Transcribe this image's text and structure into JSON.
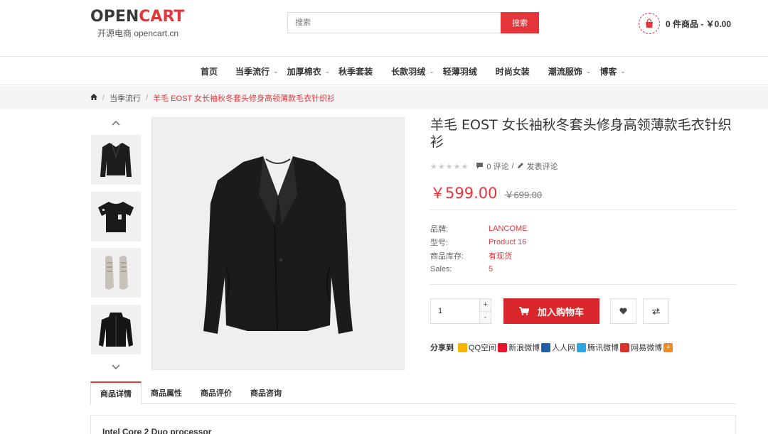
{
  "header": {
    "logo_text_dark": "OPEN",
    "logo_text_red": "CART",
    "logo_sub": "开源电商 opencart.cn",
    "search_placeholder": "搜索",
    "search_button": "搜索",
    "cart_text": "0 件商品 - ￥0.00"
  },
  "nav": {
    "items": [
      {
        "label": "首页",
        "has_caret": false
      },
      {
        "label": "当季流行",
        "has_caret": true
      },
      {
        "label": "加厚棉衣",
        "has_caret": true
      },
      {
        "label": "秋季套装",
        "has_caret": false
      },
      {
        "label": "长款羽绒",
        "has_caret": true
      },
      {
        "label": "轻薄羽绒",
        "has_caret": false
      },
      {
        "label": "时尚女装",
        "has_caret": false
      },
      {
        "label": "潮流服饰",
        "has_caret": true
      },
      {
        "label": "博客",
        "has_caret": true
      }
    ]
  },
  "breadcrumb": {
    "home_icon": "home-icon",
    "items": [
      "当季流行",
      "羊毛 EOST 女长袖秋冬套头修身高领薄款毛衣针织衫"
    ]
  },
  "gallery": {
    "thumbnails": [
      "black-blazer",
      "black-tshirt",
      "grey-sneakers",
      "black-zip-jacket"
    ],
    "main": "black-blazer"
  },
  "product": {
    "title": "羊毛 EOST 女长袖秋冬套头修身高领薄款毛衣针织衫",
    "rating": 0,
    "reviews_text": "0 评论",
    "write_review": "发表评论",
    "price": "￥599.00",
    "old_price": "￥699.00",
    "specs": [
      {
        "label": "品牌:",
        "value": "LANCOME"
      },
      {
        "label": "型号:",
        "value": "Product 16"
      },
      {
        "label": "商品库存:",
        "value": "有现货"
      },
      {
        "label": "Sales:",
        "value": "5"
      }
    ],
    "quantity": "1",
    "add_to_cart": "加入购物车"
  },
  "share": {
    "label": "分享到",
    "items": [
      {
        "label": "QQ空间",
        "color": "#f5b400"
      },
      {
        "label": "新浪微博",
        "color": "#e6162d"
      },
      {
        "label": "人人网",
        "color": "#1f5fa8"
      },
      {
        "label": "腾讯微博",
        "color": "#2aa7e0"
      },
      {
        "label": "网易微博",
        "color": "#d9332e"
      }
    ]
  },
  "tabs": {
    "items": [
      "商品详情",
      "商品属性",
      "商品评价",
      "商品咨询"
    ],
    "active": 0,
    "content_preview": "Intel Core 2 Duo processor"
  },
  "colors": {
    "accent": "#e4353b"
  }
}
